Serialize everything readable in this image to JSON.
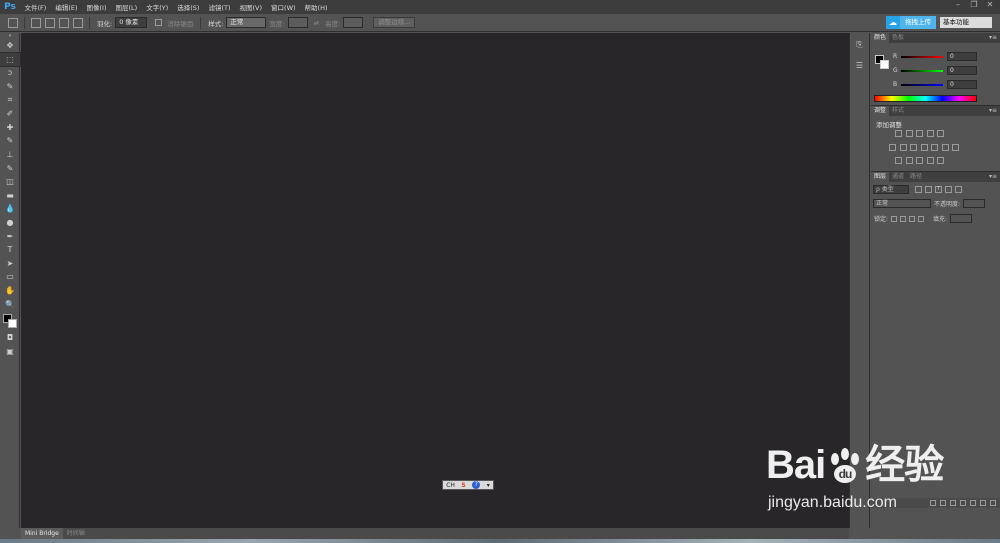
{
  "app": {
    "logo": "Ps"
  },
  "menu": [
    "文件(F)",
    "编辑(E)",
    "图像(I)",
    "图层(L)",
    "文字(Y)",
    "选择(S)",
    "滤镜(T)",
    "视图(V)",
    "窗口(W)",
    "帮助(H)"
  ],
  "window_controls": {
    "minimize": "–",
    "restore": "❐",
    "close": "✕"
  },
  "options": {
    "feather_label": "羽化:",
    "feather_value": "0 像素",
    "antialias_label": "消除锯齿",
    "style_label": "样式:",
    "style_value": "正常",
    "width_label": "宽度:",
    "height_label": "高度:",
    "refine_edge": "调整边缘...",
    "upload_label": "拖拽上传",
    "workspace": "基本功能"
  },
  "toolbar": {
    "tools": [
      "move-tool",
      "marquee-tool",
      "lasso-tool",
      "quick-select-tool",
      "crop-tool",
      "eyedropper-tool",
      "healing-brush-tool",
      "brush-tool",
      "clone-stamp-tool",
      "history-brush-tool",
      "eraser-tool",
      "gradient-tool",
      "blur-tool",
      "dodge-tool",
      "pen-tool",
      "type-tool",
      "path-selection-tool",
      "rectangle-tool",
      "hand-tool",
      "zoom-tool"
    ],
    "glyphs": [
      "✥",
      "⬚",
      "ↄ",
      "✎",
      "⌗",
      "✐",
      "✚",
      "✎",
      "⊥",
      "✎",
      "◫",
      "▬",
      "💧",
      "●",
      "✒",
      "T",
      "➤",
      "▭",
      "✋",
      "🔍"
    ],
    "type_glyph": "T"
  },
  "ime": {
    "lang": "CH",
    "logo": "S",
    "help": "?",
    "menu": "▾"
  },
  "statusbar": {
    "tabs": [
      "Mini Bridge",
      "时间轴"
    ]
  },
  "panels": {
    "color": {
      "tabs": [
        "颜色",
        "色板"
      ],
      "channels": [
        "R",
        "G",
        "B"
      ],
      "values": [
        "0",
        "0",
        "0"
      ],
      "menu": "▾≡"
    },
    "adjustments": {
      "tabs": [
        "调整",
        "样式"
      ],
      "title": "添加调整",
      "menu": "▾≡"
    },
    "layers": {
      "tabs": [
        "图层",
        "通道",
        "路径"
      ],
      "filter": "ρ 类型",
      "blend": "正常",
      "opacity_label": "不透明度:",
      "lock_label": "锁定:",
      "fill_label": "填充:",
      "menu": "▾≡"
    }
  },
  "watermark": {
    "logo_left": "Bai",
    "logo_right": "经验",
    "url": "jingyan.baidu.com"
  },
  "colors": {
    "accent": "#29a3e6",
    "canvas": "#282629",
    "chrome": "#535353"
  }
}
